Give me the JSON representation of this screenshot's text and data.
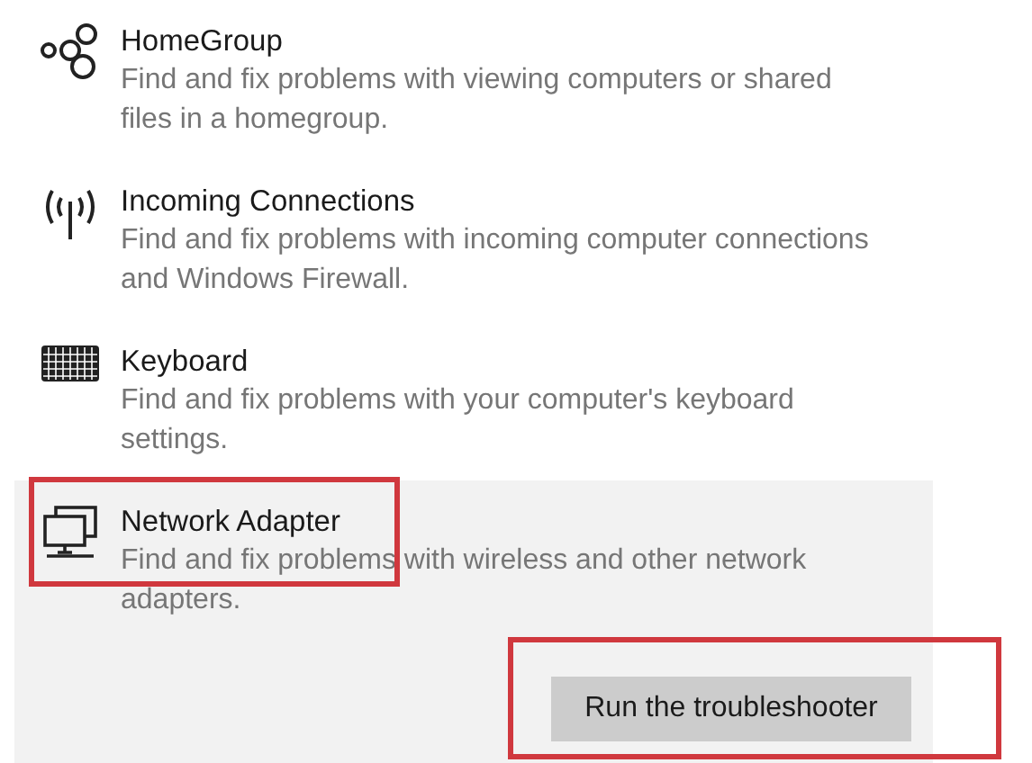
{
  "troubleshooters": [
    {
      "kind": "homegroup",
      "title": "HomeGroup",
      "description": "Find and fix problems with viewing computers or shared\nfiles in a homegroup.",
      "selected": false,
      "highlighted": false
    },
    {
      "kind": "antenna",
      "title": "Incoming Connections",
      "description": "Find and fix problems with incoming computer connections\nand Windows Firewall.",
      "selected": false,
      "highlighted": false
    },
    {
      "kind": "keyboard",
      "title": "Keyboard",
      "description": "Find and fix problems with your computer's keyboard\nsettings.",
      "selected": false,
      "highlighted": false
    },
    {
      "kind": "network",
      "title": "Network Adapter",
      "description": "Find and fix problems with wireless and other network\nadapters.",
      "selected": true,
      "highlighted": true
    }
  ],
  "run_button": {
    "label": "Run the troubleshooter",
    "highlighted": true
  }
}
